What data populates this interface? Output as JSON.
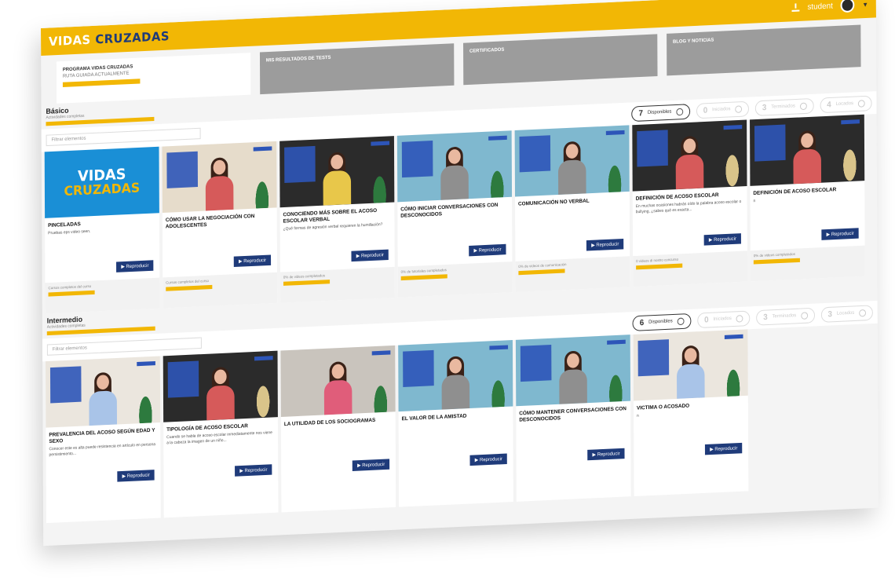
{
  "topbar": {
    "logo_part1": "VIDAS",
    "logo_part2": "CRUZADAS",
    "user_label": "student"
  },
  "programs": [
    {
      "title": "PROGRAMA VIDAS CRUZADAS",
      "sub": "RUTA GUIADA ACTUALMENTE",
      "active": true
    },
    {
      "title": "MIS RESULTADOS DE TESTS",
      "sub": "",
      "active": false
    },
    {
      "title": "CERTIFICADOS",
      "sub": "",
      "active": false
    },
    {
      "title": "BLOG Y NOTICIAS",
      "sub": "",
      "active": false
    }
  ],
  "sections": [
    {
      "title": "Básico",
      "sub": "Actividades completas",
      "filter_placeholder": "Filtrar elementos",
      "pills": [
        {
          "n": "7",
          "label": "Disponibles"
        },
        {
          "n": "0",
          "label": "Iniciados"
        },
        {
          "n": "3",
          "label": "Terminados"
        },
        {
          "n": "4",
          "label": "Locados"
        }
      ],
      "cards": [
        {
          "title": "PINCELADAS",
          "desc": "Pruebas eps video seen.",
          "play": "Reproducir",
          "foot": "Cursos completos del curso",
          "theme": "logo"
        },
        {
          "title": "CÓMO USAR LA NEGOCIACIÓN CON ADOLESCENTES",
          "desc": "",
          "play": "Reproducir",
          "foot": "Cursos completos del curso",
          "theme": "beige"
        },
        {
          "title": "CONOCIENDO MÁS SOBRE EL ACOSO ESCOLAR VERBAL",
          "desc": "¿Qué formas de agresión verbal requieren la humillación?",
          "play": "Reproducir",
          "foot": "0% de videos completados",
          "theme": "dark"
        },
        {
          "title": "CÓMO INICIAR CONVERSACIONES CON DESCONOCIDOS",
          "desc": "",
          "play": "Reproducir",
          "foot": "0% de tutoriales completados",
          "theme": "teal"
        },
        {
          "title": "COMUNICACIÓN NO VERBAL",
          "desc": "",
          "play": "Reproducir",
          "foot": "0% de videos de comunicación",
          "theme": "teal2"
        },
        {
          "title": "DEFINICIÓN DE ACOSO ESCOLAR",
          "desc": "En muchas ocasiones habrás oído la palabra acoso escolar o bullying, ¿sabes qué es exacta...",
          "play": "Reproducir",
          "foot": "0 videos di nostro concurso",
          "theme": "dark2"
        },
        {
          "title": "DEFINICIÓN DE ACOSO ESCOLAR",
          "desc": "n",
          "play": "Reproducir",
          "foot": "0% de videos completados",
          "theme": "dark3"
        }
      ]
    },
    {
      "title": "Intermedio",
      "sub": "Actividades completas",
      "filter_placeholder": "Filtrar elementos",
      "pills": [
        {
          "n": "6",
          "label": "Disponibles"
        },
        {
          "n": "0",
          "label": "Iniciados"
        },
        {
          "n": "3",
          "label": "Terminados"
        },
        {
          "n": "3",
          "label": "Locados"
        }
      ],
      "cards": [
        {
          "title": "PREVALENCIA DEL ACOSO SEGÚN EDAD Y SEXO",
          "desc": "Conocer este es alta puede resistencia en artículo en persona persistimiento...",
          "play": "Reproducir",
          "foot": "",
          "theme": "light"
        },
        {
          "title": "TIPOLOGÍA DE ACOSO ESCOLAR",
          "desc": "Cuando se habla de acoso escolar inmediatamente nos viene a la cabeza la imagen de un niño...",
          "play": "Reproducir",
          "foot": "",
          "theme": "dark2"
        },
        {
          "title": "LA UTILIDAD DE LOS SOCIOGRAMAS",
          "desc": "",
          "play": "Reproducir",
          "foot": "",
          "theme": "grey"
        },
        {
          "title": "EL VALOR DE LA AMISTAD",
          "desc": "",
          "play": "Reproducir",
          "foot": "",
          "theme": "teal"
        },
        {
          "title": "CÓMO MANTENER CONVERSACIONES CON DESCONOCIDOS",
          "desc": "",
          "play": "Reproducir",
          "foot": "",
          "theme": "teal2"
        },
        {
          "title": "VICTIMA O ACOSADO",
          "desc": "n",
          "play": "Reproducir",
          "foot": "",
          "theme": "light2"
        }
      ]
    }
  ]
}
